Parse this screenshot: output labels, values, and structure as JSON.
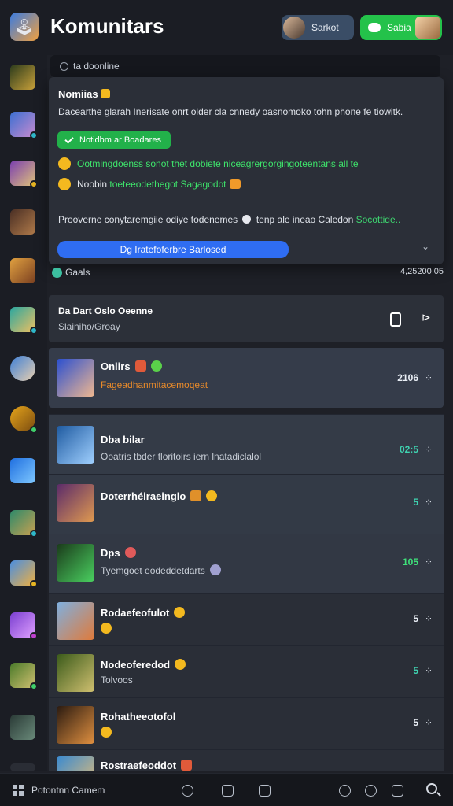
{
  "header": {
    "title": "Komunitars",
    "user_name": "Sarkot",
    "status_label": "Sabia"
  },
  "search": {
    "label": "ta doonline"
  },
  "popup": {
    "title": "Nomiias",
    "description": "Dacearthe glarah Inerisate onrt older cla cnnedy oasnomoko tohn phone fe tiowitk.",
    "badge": "Notidbm ar Boadares",
    "row1": "Ootmingdoenss sonot thet dobiete niceagrergorgingoteentans all te",
    "row2_prefix": "Noobin",
    "row2_green": "toeteeodethegot Sagagodot",
    "long_text": "Prooverne conytaremgiie odiye todenemes",
    "long_text_mid": "tenp ale ineao Caledon",
    "long_text_green": "Socottide..",
    "button": "Dg Iratefoferbre Barlosed",
    "chevron": "⌄"
  },
  "games": {
    "label": "Gaals",
    "count": "4,25200 05"
  },
  "info_card": {
    "title": "Da Dart Oslo Oeenne",
    "subtitle": "Slainiho/Groay",
    "arrow": "⊳"
  },
  "feature": {
    "title": "Onlirs",
    "subtitle": "Fageadhanmitacemoqeat",
    "count": "2106",
    "more": "⁘"
  },
  "list": [
    {
      "title": "Dba bilar",
      "subtitle": "Ooatris tbder tloritoirs iern lnatadiclalol",
      "count": "02:5",
      "count_color": "#3fd2b0",
      "more": "⁘"
    },
    {
      "title": "Doterrhéiraeinglo",
      "subtitle": "",
      "count": "5",
      "count_color": "#3fd2b0",
      "more": "⁘"
    },
    {
      "title": "Dps",
      "subtitle": "Tyemgoet eodeddetdarts",
      "count": "105",
      "count_color": "#3fe07a",
      "more": "⁘"
    },
    {
      "title": "Rodaefeofulot",
      "subtitle": "",
      "count": "5",
      "count_color": "#e9eef5",
      "more": "⁘"
    },
    {
      "title": "Nodeoferedod",
      "subtitle": "Tolvoos",
      "count": "5",
      "count_color": "#3fd2b0",
      "more": "⁘"
    },
    {
      "title": "Rohatheeotofol",
      "subtitle": "",
      "count": "5",
      "count_color": "#e9eef5",
      "more": "⁘"
    },
    {
      "title": "Rostraefeoddot",
      "subtitle": "",
      "count": "",
      "count_color": "#e9eef5",
      "more": ""
    }
  ],
  "bottom": {
    "label": "Potontnn Camem"
  }
}
